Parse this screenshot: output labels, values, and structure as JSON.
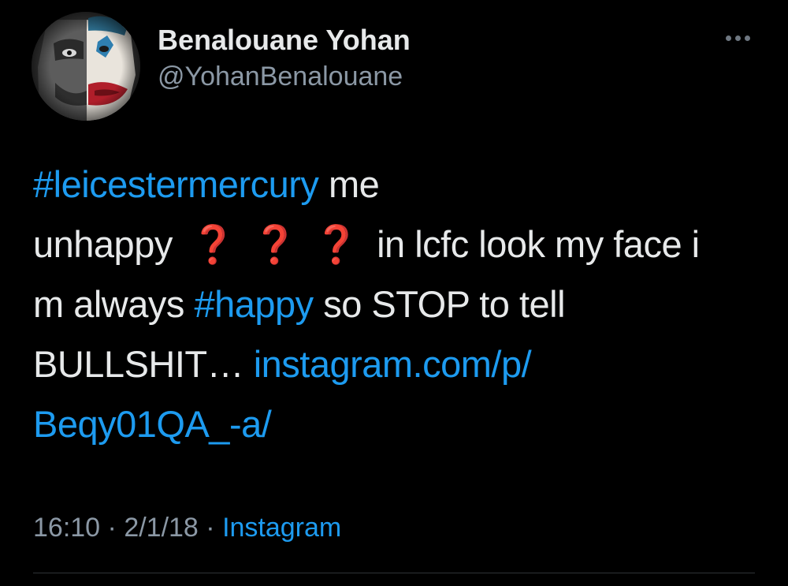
{
  "author": {
    "name": "Benalouane Yohan",
    "handle": "@YohanBenalouane"
  },
  "tweet": {
    "line1": {
      "hashtag": "#leicestermercury",
      "text": " me"
    },
    "line2": {
      "text_before": "unhappy",
      "marks": [
        "❓",
        "❓",
        "❓"
      ],
      "text_after": "in lcfc look my face i"
    },
    "line3": {
      "text_before": "m always ",
      "hashtag": "#happy",
      "text_after": " so STOP to tell"
    },
    "line4": {
      "text": "BULLSHIT… ",
      "link": "instagram.com/p/"
    },
    "line5": {
      "link": "Beqy01QA_-a/"
    }
  },
  "meta": {
    "time": "16:10",
    "separator1": " · ",
    "date": "2/1/18",
    "separator2": " · ",
    "source": "Instagram"
  },
  "colors": {
    "background": "#000000",
    "text": "#e7e9ea",
    "secondary": "#8b98a5",
    "link": "#1d9bf0",
    "question_mark": "#e0182d"
  },
  "icons": {
    "more": "more-horizontal-icon",
    "avatar": "joker-face-avatar"
  }
}
